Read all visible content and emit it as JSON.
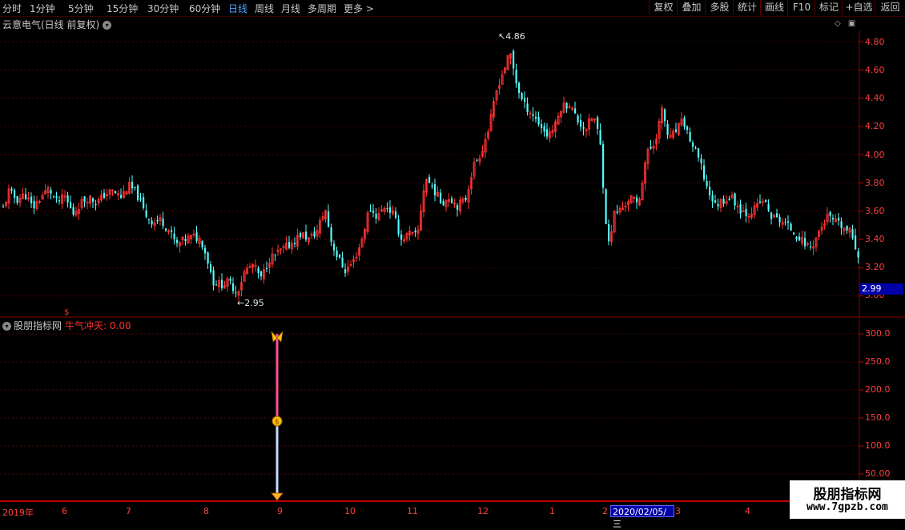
{
  "toolbar": {
    "periods": [
      "分时",
      "1分钟",
      "5分钟",
      "15分钟",
      "30分钟",
      "60分钟",
      "日线",
      "周线",
      "月线",
      "多周期",
      "更多 >"
    ],
    "active_period": "日线",
    "buttons": [
      "复权",
      "叠加",
      "多股",
      "统计",
      "画线",
      "F10",
      "标记",
      "+自选",
      "返回"
    ]
  },
  "main_panel": {
    "title": "云意电气(日线 前复权)",
    "y_ticks": [
      "4.80",
      "4.60",
      "4.40",
      "4.20",
      "4.00",
      "3.80",
      "3.60",
      "3.40",
      "3.20",
      "3.00"
    ],
    "high_label": "4.86",
    "low_label": "2.95",
    "last_price": "2.99",
    "colors": {
      "up": "#ff3232",
      "down": "#54fcfc"
    }
  },
  "indicator_panel": {
    "name": "股朋指标网",
    "line_label": "牛气冲天: 0.00",
    "y_ticks": [
      "300.0",
      "250.0",
      "200.0",
      "150.0",
      "100.0",
      "50.00"
    ],
    "bar": {
      "top_value": 300,
      "mid_value": 150,
      "bottom_value": 0
    },
    "icons": [
      "butterfly-icon",
      "coin-icon",
      "diamond-icon"
    ]
  },
  "x_axis": {
    "labels": [
      "2019年",
      "6",
      "7",
      "8",
      "9",
      "10",
      "11",
      "12",
      "1",
      "2",
      "3",
      "4"
    ],
    "cursor_date": "2020/02/05/三"
  },
  "watermark": {
    "line1": "股朋指标网",
    "line2": "www.7gpzb.com"
  }
}
